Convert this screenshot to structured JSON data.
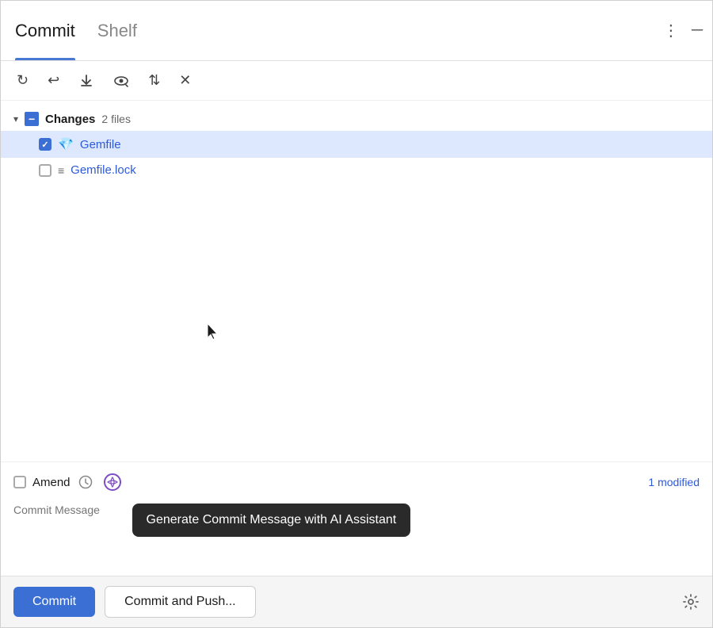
{
  "tabs": {
    "active": "Commit",
    "items": [
      {
        "id": "commit",
        "label": "Commit",
        "active": true
      },
      {
        "id": "shelf",
        "label": "Shelf",
        "active": false
      }
    ]
  },
  "toolbar": {
    "icons": [
      {
        "name": "refresh-icon",
        "symbol": "↻"
      },
      {
        "name": "undo-icon",
        "symbol": "↩"
      },
      {
        "name": "update-icon",
        "symbol": "⬇"
      },
      {
        "name": "eye-icon",
        "symbol": "◎"
      },
      {
        "name": "expand-icon",
        "symbol": "⇅"
      },
      {
        "name": "collapse-icon",
        "symbol": "✕"
      }
    ]
  },
  "file_tree": {
    "group": {
      "label": "Changes",
      "count": "2 files"
    },
    "files": [
      {
        "id": "gemfile",
        "name": "Gemfile",
        "checked": true,
        "icon": "💎"
      },
      {
        "id": "gemfile-lock",
        "name": "Gemfile.lock",
        "checked": false,
        "icon": "≡"
      }
    ]
  },
  "amend": {
    "label": "Amend",
    "checked": false
  },
  "modified_label": "1 modified",
  "commit_message_placeholder": "Commit Message",
  "tooltip": {
    "text": "Generate Commit Message with AI Assistant"
  },
  "footer": {
    "commit_label": "Commit",
    "commit_push_label": "Commit and Push...",
    "settings_icon": "⚙"
  },
  "header_menu_icon": "⋮",
  "header_minimize_icon": "─"
}
